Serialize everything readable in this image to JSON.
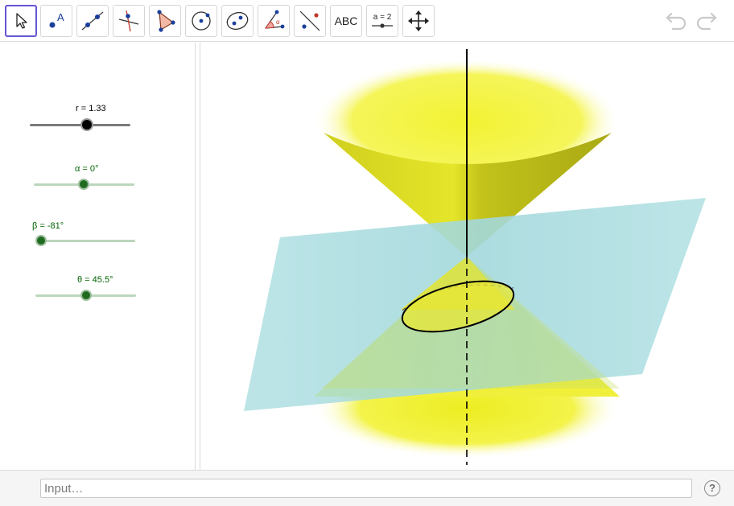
{
  "toolbar": {
    "tools": [
      {
        "name": "move-tool",
        "selected": true
      },
      {
        "name": "point-tool"
      },
      {
        "name": "line-tool"
      },
      {
        "name": "perpendicular-line-tool"
      },
      {
        "name": "polygon-tool"
      },
      {
        "name": "circle-tool"
      },
      {
        "name": "conic-tool"
      },
      {
        "name": "angle-tool"
      },
      {
        "name": "reflect-tool"
      },
      {
        "name": "text-tool",
        "label": "ABC"
      },
      {
        "name": "slider-tool",
        "label": "a = 2"
      },
      {
        "name": "move-graphics-view-tool"
      }
    ],
    "undo_icon": "undo-icon",
    "redo_icon": "redo-icon"
  },
  "sliders": [
    {
      "id": "r",
      "label": "r = 1.33",
      "value": 1.33,
      "color": "#000000",
      "track_color": "#7a7a7a"
    },
    {
      "id": "alpha",
      "label": "α = 0°",
      "value": 0,
      "color": "#006400",
      "track_color": "#b9d6b9"
    },
    {
      "id": "beta",
      "label": "β = -81°",
      "value": -81,
      "color": "#006400",
      "track_color": "#b9d6b9"
    },
    {
      "id": "theta",
      "label": "θ = 45.5°",
      "value": 45.5,
      "color": "#006400",
      "track_color": "#b9d6b9"
    }
  ],
  "graphics": {
    "cone_color": "#e8e800",
    "plane_color": "#9fd6d9",
    "section_curve": "ellipse"
  },
  "input": {
    "placeholder": "Input…"
  },
  "help": {
    "label": "?"
  }
}
